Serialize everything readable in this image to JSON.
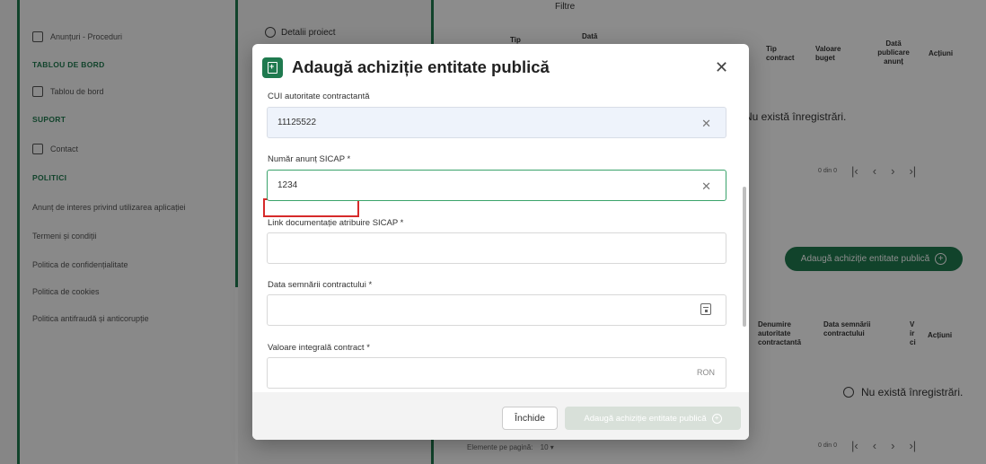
{
  "sidebar": {
    "items": [
      {
        "label": "Anunțuri - Proceduri",
        "icon": "document-icon"
      },
      {
        "label": "Tablou de bord",
        "icon": "dashboard-icon"
      },
      {
        "label": "Contact",
        "icon": "mail-icon"
      }
    ],
    "sections": [
      "TABLOU DE BORD",
      "SUPORT",
      "POLITICI"
    ],
    "policies": [
      "Anunț de interes privind utilizarea aplicației",
      "Termeni și condiții",
      "Politica de confidențialitate",
      "Politica de cookies",
      "Politica antifraudă și anticorupție"
    ]
  },
  "middle": {
    "detalii": "Detalii proiect"
  },
  "main": {
    "filtre": "Filtre",
    "table1": {
      "headers": [
        "Tip",
        "Dată",
        "Tip contract",
        "Valoare buget",
        "Dată publicare anunț",
        "Acțiuni"
      ],
      "empty": "Nu există înregistrări."
    },
    "pager1": "0 din 0",
    "add_button": "Adaugă achiziție entitate publică",
    "table2": {
      "headers": [
        "Denumire autoritate contractantă",
        "Data semnării contractului",
        "V ir ci",
        "Acțiuni"
      ],
      "empty": "Nu există înregistrări."
    },
    "pager2": "0 din 0",
    "per_page_label": "Elemente pe pagină:",
    "per_page_value": "10"
  },
  "modal": {
    "title": "Adaugă achiziție entitate publică",
    "fields": {
      "cui": {
        "label": "CUI autoritate contractantă",
        "value": "11125522"
      },
      "sicap": {
        "label": "Număr anunț SICAP *",
        "value": "1234"
      },
      "link": {
        "label": "Link documentație atribuire SICAP *",
        "value": ""
      },
      "data": {
        "label": "Data semnării contractului *",
        "value": ""
      },
      "valoare": {
        "label": "Valoare integrală contract *",
        "value": "",
        "unit": "RON"
      }
    },
    "close_button": "Închide",
    "submit_button": "Adaugă achiziție entitate publică"
  },
  "colors": {
    "accent": "#1f7a4f",
    "highlight": "#d62a2a"
  }
}
